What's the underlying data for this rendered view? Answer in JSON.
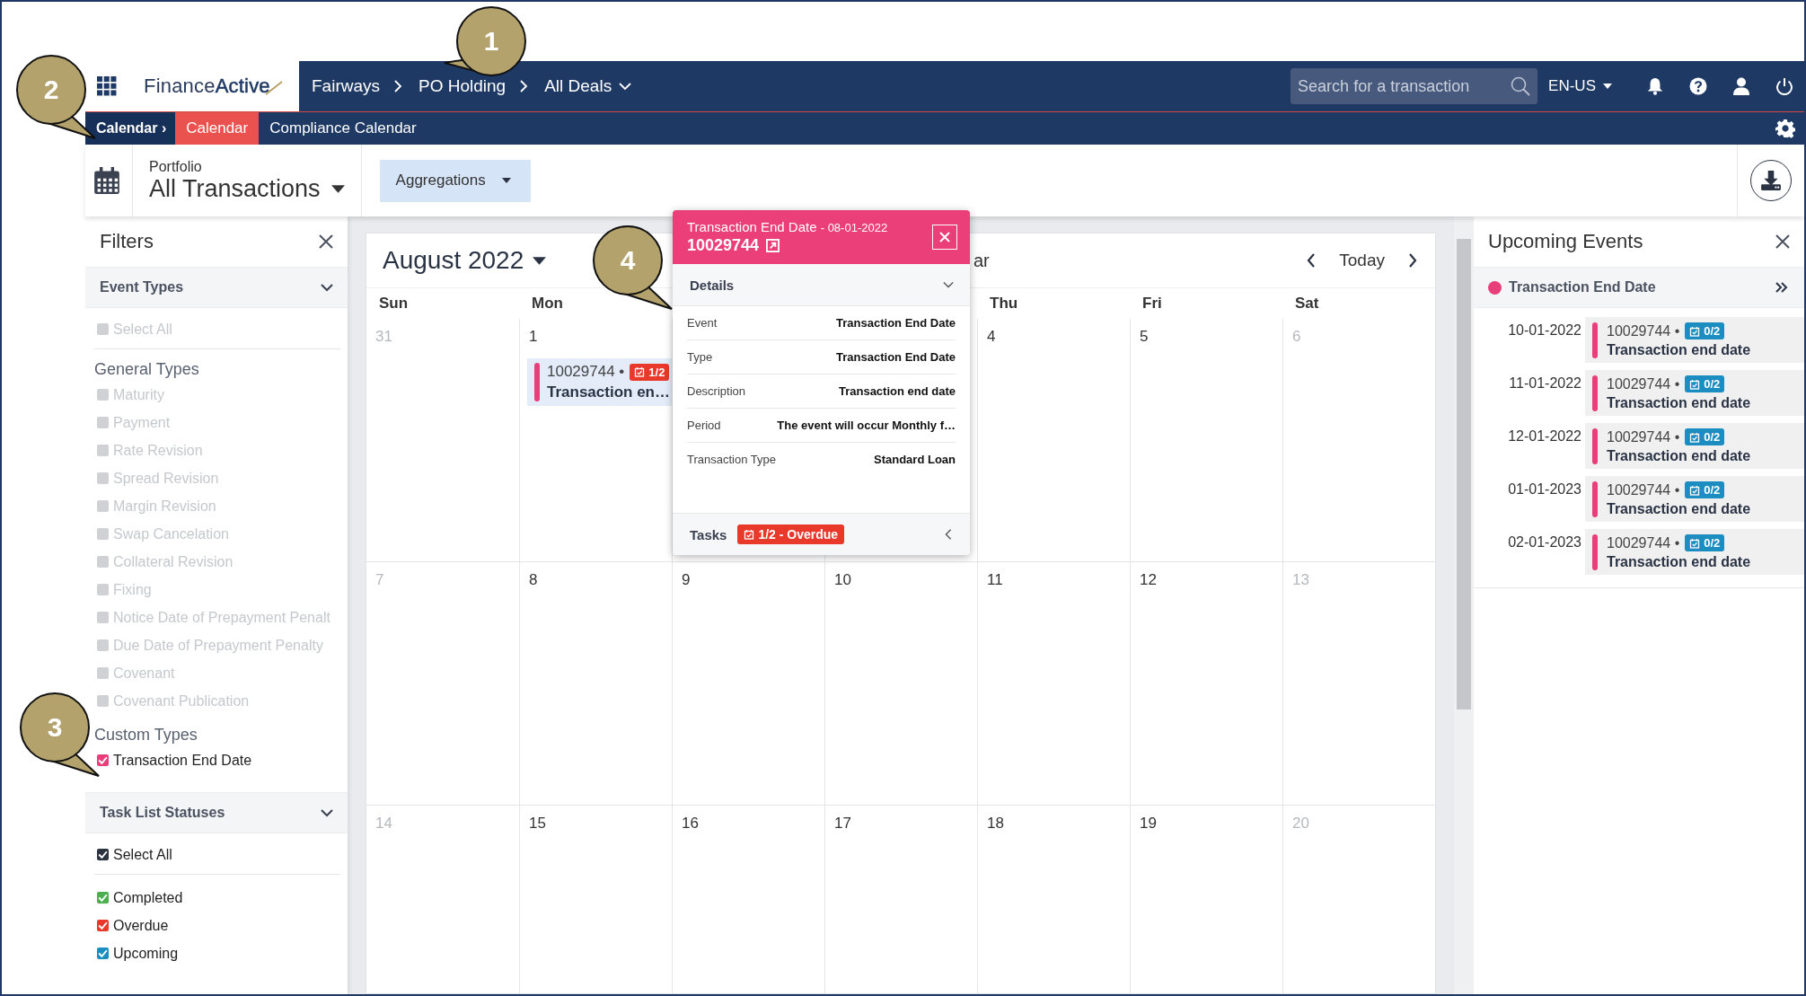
{
  "brand": {
    "name_regular": "Finance",
    "name_bold": "Active"
  },
  "breadcrumbs": [
    {
      "label": "Fairways",
      "dropdown": false
    },
    {
      "label": "PO Holding",
      "dropdown": false
    },
    {
      "label": "All Deals",
      "dropdown": true
    }
  ],
  "search": {
    "placeholder": "Search for a transaction"
  },
  "language": "EN-US",
  "subnav": {
    "section": "Calendar ›",
    "tabs": [
      {
        "label": "Calendar",
        "selected": true
      },
      {
        "label": "Compliance Calendar",
        "selected": false
      }
    ]
  },
  "toolbar": {
    "portfolio_label": "Portfolio",
    "portfolio_value": "All Transactions",
    "aggregations": "Aggregations"
  },
  "filters": {
    "title": "Filters",
    "sections": [
      {
        "title": "Event Types",
        "expanded": true,
        "select_all": {
          "label": "Select All",
          "checked": false,
          "disabled": true
        },
        "groups": [
          {
            "heading": "General Types",
            "items": [
              {
                "label": "Maturity",
                "checked": false,
                "disabled": true
              },
              {
                "label": "Payment",
                "checked": false,
                "disabled": true
              },
              {
                "label": "Rate Revision",
                "checked": false,
                "disabled": true
              },
              {
                "label": "Spread Revision",
                "checked": false,
                "disabled": true
              },
              {
                "label": "Margin Revision",
                "checked": false,
                "disabled": true
              },
              {
                "label": "Swap Cancelation",
                "checked": false,
                "disabled": true
              },
              {
                "label": "Collateral Revision",
                "checked": false,
                "disabled": true
              },
              {
                "label": "Fixing",
                "checked": false,
                "disabled": true
              },
              {
                "label": "Notice Date of Prepayment Penalt",
                "checked": false,
                "disabled": true
              },
              {
                "label": "Due Date of Prepayment Penalty",
                "checked": false,
                "disabled": true
              },
              {
                "label": "Covenant",
                "checked": false,
                "disabled": true
              },
              {
                "label": "Covenant Publication",
                "checked": false,
                "disabled": true
              }
            ]
          },
          {
            "heading": "Custom Types",
            "items": [
              {
                "label": "Transaction End Date",
                "checked": true,
                "disabled": false,
                "color": "#e83e7a"
              }
            ]
          }
        ]
      },
      {
        "title": "Task List Statuses",
        "expanded": true,
        "select_all": {
          "label": "Select All",
          "checked": true,
          "disabled": false,
          "color": "#2b3340"
        },
        "groups": [
          {
            "items": [
              {
                "label": "Completed",
                "checked": true,
                "disabled": false,
                "color": "#4cae4c"
              },
              {
                "label": "Overdue",
                "checked": true,
                "disabled": false,
                "color": "#e8392b"
              },
              {
                "label": "Upcoming",
                "checked": true,
                "disabled": false,
                "color": "#1b8dc0"
              }
            ]
          }
        ]
      }
    ]
  },
  "calendar": {
    "month": "August 2022",
    "partial_label": "ar",
    "today": "Today",
    "weekdays": [
      {
        "label": "Sun",
        "kind": "sun"
      },
      {
        "label": "Mon",
        "kind": "mon"
      },
      {
        "label": "Thu",
        "kind": "thu"
      },
      {
        "label": "Fri",
        "kind": "fri"
      },
      {
        "label": "Sat",
        "kind": "sat"
      }
    ],
    "weeks": [
      [
        {
          "day": "31",
          "muted": true,
          "kind": "sun"
        },
        {
          "day": "1",
          "muted": false,
          "kind": "mon",
          "events": [
            {
              "id": "10029744 •",
              "tasks": {
                "label": "1/2",
                "color": "#e8392b"
              },
              "title": "Transaction en…"
            }
          ]
        },
        {
          "day": "4",
          "muted": false,
          "kind": "thu"
        },
        {
          "day": "5",
          "muted": false,
          "kind": "fri"
        },
        {
          "day": "6",
          "muted": true,
          "kind": "sat"
        }
      ],
      [
        {
          "day": "7",
          "muted": true
        },
        {
          "day": "8",
          "muted": false
        },
        {
          "day": "9",
          "muted": false
        },
        {
          "day": "10",
          "muted": false
        },
        {
          "day": "11",
          "muted": false
        },
        {
          "day": "12",
          "muted": false
        },
        {
          "day": "13",
          "muted": true
        }
      ],
      [
        {
          "day": "14",
          "muted": true
        },
        {
          "day": "15",
          "muted": false
        },
        {
          "day": "16",
          "muted": false
        },
        {
          "day": "17",
          "muted": false
        },
        {
          "day": "18",
          "muted": false
        },
        {
          "day": "19",
          "muted": false
        },
        {
          "day": "20",
          "muted": true
        }
      ]
    ]
  },
  "popup": {
    "title": "Transaction End Date",
    "date": "- 08-01-2022",
    "id": "10029744",
    "details_label": "Details",
    "details_expanded": true,
    "rows": [
      {
        "label": "Event",
        "value": "Transaction End Date"
      },
      {
        "label": "Type",
        "value": "Transaction End Date"
      },
      {
        "label": "Description",
        "value": "Transaction end date"
      },
      {
        "label": "Period",
        "value": "The event will occur Monthly f…"
      },
      {
        "label": "Transaction Type",
        "value": "Standard Loan"
      }
    ],
    "tasks_label": "Tasks",
    "tasks_badge": {
      "label": "1/2 - Overdue",
      "color": "#e8392b"
    }
  },
  "upcoming": {
    "title": "Upcoming Events",
    "group": {
      "label": "Transaction End Date",
      "color": "#e83e7a"
    },
    "events": [
      {
        "date": "10-01-2022",
        "id": "10029744 •",
        "tasks": {
          "label": "0/2",
          "color": "#1b8dc0"
        },
        "title": "Transaction end date"
      },
      {
        "date": "11-01-2022",
        "id": "10029744 •",
        "tasks": {
          "label": "0/2",
          "color": "#1b8dc0"
        },
        "title": "Transaction end date"
      },
      {
        "date": "12-01-2022",
        "id": "10029744 •",
        "tasks": {
          "label": "0/2",
          "color": "#1b8dc0"
        },
        "title": "Transaction end date"
      },
      {
        "date": "01-01-2023",
        "id": "10029744 •",
        "tasks": {
          "label": "0/2",
          "color": "#1b8dc0"
        },
        "title": "Transaction end date"
      },
      {
        "date": "02-01-2023",
        "id": "10029744 •",
        "tasks": {
          "label": "0/2",
          "color": "#1b8dc0"
        },
        "title": "Transaction end date"
      }
    ]
  },
  "callouts": [
    {
      "number": "1"
    },
    {
      "number": "2"
    },
    {
      "number": "3"
    },
    {
      "number": "4"
    }
  ]
}
